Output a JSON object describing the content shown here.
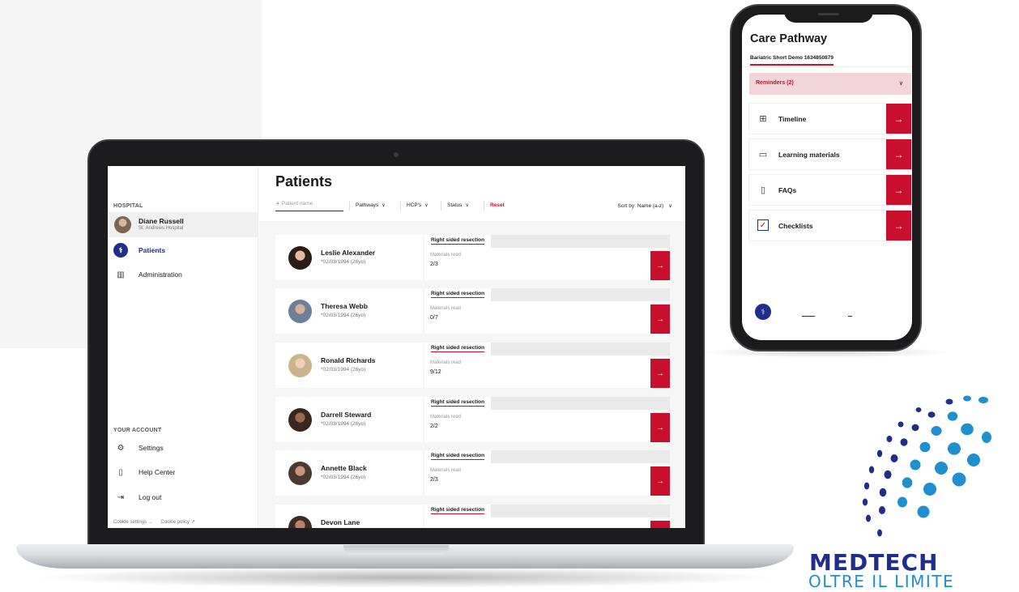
{
  "laptop": {
    "sidebar": {
      "section_hospital": "HOSPITAL",
      "user": {
        "name": "Diane Russell",
        "hospital": "St. Andrews Hospital"
      },
      "nav": [
        {
          "label": "Patients",
          "icon": "stethoscope-icon"
        },
        {
          "label": "Administration",
          "icon": "building-icon"
        }
      ],
      "section_account": "YOUR ACCOUNT",
      "account": [
        {
          "label": "Settings",
          "icon": "gear-icon"
        },
        {
          "label": "Help Center",
          "icon": "help-icon"
        },
        {
          "label": "Log out",
          "icon": "logout-icon"
        }
      ],
      "cookie_settings": "Cookie settings →",
      "cookie_policy": "Cookie policy ↗"
    },
    "main": {
      "title": "Patients",
      "search_placeholder": "Patient name",
      "filters": {
        "pathways": "Pathways",
        "hcps": "HCP's",
        "status": "Status",
        "reset": "Reset"
      },
      "sort": "Sort by:  Name (a-z)",
      "materials_label": "Materials read",
      "patients": [
        {
          "name": "Leslie Alexander",
          "dob": "*02/03/1994 (26yo)",
          "pathway": "Right sided resection",
          "materials": "2/3"
        },
        {
          "name": "Theresa Webb",
          "dob": "*02/03/1994 (26yo)",
          "pathway": "Right sided resection",
          "materials": "0/7"
        },
        {
          "name": "Ronald Richards",
          "dob": "*02/03/1994 (26yo)",
          "pathway": "Right sided resection",
          "materials": "9/12"
        },
        {
          "name": "Darrell Steward",
          "dob": "*02/03/1994 (26yo)",
          "pathway": "Right sided resection",
          "materials": "2/2"
        },
        {
          "name": "Annette Black",
          "dob": "*02/03/1994 (26yo)",
          "pathway": "Right sided resection",
          "materials": "2/3"
        },
        {
          "name": "Devon Lane",
          "dob": "",
          "pathway": "Right sided resection",
          "materials": ""
        }
      ]
    }
  },
  "phone": {
    "title": "Care Pathway",
    "subtitle": "Bariatric Short Demo 1634850879",
    "reminders": "Reminders (2)",
    "rows": [
      {
        "label": "Timeline",
        "icon": "timeline-icon"
      },
      {
        "label": "Learning materials",
        "icon": "monitor-icon"
      },
      {
        "label": "FAQs",
        "icon": "faq-icon"
      },
      {
        "label": "Checklists",
        "icon": "checkbox-icon"
      }
    ]
  },
  "logo": {
    "line1": "MEDTECH",
    "line2": "OLTRE IL LIMITE"
  },
  "colors": {
    "accent_red": "#c8102e",
    "navy": "#1f2e8a",
    "logo_blue": "#1f8fd0"
  }
}
